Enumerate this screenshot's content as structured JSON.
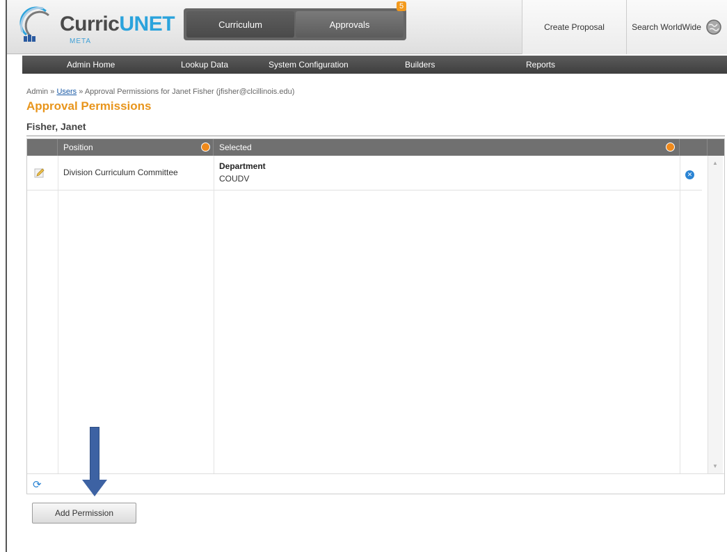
{
  "header": {
    "logo_text_a": "Curric",
    "logo_text_b": "UNET",
    "logo_sub": "META",
    "tabs": [
      {
        "label": "Curriculum"
      },
      {
        "label": "Approvals"
      }
    ],
    "approvals_badge": "5",
    "create_label": "Create Proposal",
    "search_label": "Search WorldWide"
  },
  "menu": {
    "items": [
      {
        "label": "Admin Home"
      },
      {
        "label": "Lookup Data"
      },
      {
        "label": "System Configuration"
      },
      {
        "label": "Builders"
      },
      {
        "label": "Reports"
      }
    ]
  },
  "breadcrumb": {
    "root": "Admin",
    "sep": "»",
    "users": "Users",
    "current": "Approval Permissions for Janet Fisher (jfisher@clcillinois.edu)"
  },
  "page": {
    "title": "Approval Permissions",
    "user_name": "Fisher, Janet"
  },
  "grid": {
    "columns": [
      {
        "label": "Position"
      },
      {
        "label": "Selected"
      }
    ],
    "rows": [
      {
        "position": "Division Curriculum Committee",
        "selected_type": "Department",
        "selected_value": "COUDV"
      }
    ]
  },
  "actions": {
    "add_permission": "Add Permission"
  },
  "colors": {
    "accent_orange": "#e8951c",
    "link_blue": "#1a5aa6",
    "annotation_arrow": "#3d62a3"
  }
}
